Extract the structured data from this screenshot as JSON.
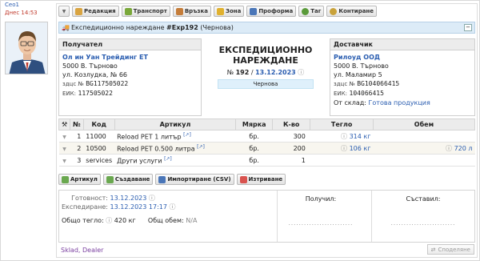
{
  "user": {
    "name": "Ceo1",
    "time": "Днес 14:53"
  },
  "toolbar": {
    "buttons": [
      {
        "label": "Редакция",
        "color": "#d9a441"
      },
      {
        "label": "Транспорт",
        "color": "#7aa83a"
      },
      {
        "label": "Връзка",
        "color": "#c57d3a"
      },
      {
        "label": "Зона",
        "color": "#e0b12f"
      },
      {
        "label": "Проформа",
        "color": "#4a76b8"
      },
      {
        "label": "Таг",
        "color": "#5a9a3a"
      },
      {
        "label": "Контиране",
        "color": "#c9a23a"
      }
    ]
  },
  "title": {
    "prefix": "Експедиционно нареждане",
    "code": "#Exp192",
    "state": "(Чернова)"
  },
  "receiver": {
    "caption": "Получател",
    "name": "Ол ин Уан Трейдинг ЕТ",
    "addr1": "5000 В. Търново",
    "addr2": "ул. Козлудка, № 66",
    "vat_label": "здцс №",
    "vat": "BG117505022",
    "eik_label": "ЕИК:",
    "eik": "117505022"
  },
  "doc": {
    "title_line1": "ЕКСПЕДИЦИОННО",
    "title_line2": "НАРЕЖДАНЕ",
    "no_label": "№",
    "number": "192",
    "separator": "/",
    "date": "13.12.2023",
    "status": "Чернова"
  },
  "supplier": {
    "caption": "Доставчик",
    "name": "Рилоуд ООД",
    "addr1": "5000 В. Търново",
    "addr2": "ул. Маламир 5",
    "vat_label": "здцс №",
    "vat": "BG104066415",
    "eik_label": "ЕИК:",
    "eik": "104066415",
    "warehouse_label": "От склад:",
    "warehouse": "Готова продукция"
  },
  "table": {
    "headers": {
      "no": "№",
      "code": "Код",
      "article": "Артикул",
      "unit": "Мярка",
      "qty": "К-во",
      "weight": "Тегло",
      "volume": "Обем"
    },
    "rows": [
      {
        "no": "1",
        "code": "11000",
        "article": "Reload PET 1 литър",
        "unit": "бр.",
        "qty": "300",
        "weight": "314 кг",
        "volume": ""
      },
      {
        "no": "2",
        "code": "10500",
        "article": "Reload PET 0.500 литра",
        "unit": "бр.",
        "qty": "200",
        "weight": "106 кг",
        "volume": "720 л"
      },
      {
        "no": "3",
        "code": "services",
        "article": "Други услуги",
        "unit": "бр.",
        "qty": "1",
        "weight": "",
        "volume": ""
      }
    ]
  },
  "actions": {
    "article": "Артикул",
    "create": "Създаване",
    "import": "Импортиране (CSV)",
    "delete": "Изтриване"
  },
  "footer": {
    "ready_label": "Готовност:",
    "ready": "13.12.2023",
    "ship_label": "Експедиране:",
    "ship": "13.12.2023 17:17",
    "weight_label": "Общо тегло:",
    "weight": "420 кг",
    "volume_label": "Общ обем:",
    "volume": "N/A",
    "received": "Получил:",
    "composed": "Съставил:",
    "dots": "........................."
  },
  "tags": "Sklad, Dealer",
  "share": "Споделяне"
}
